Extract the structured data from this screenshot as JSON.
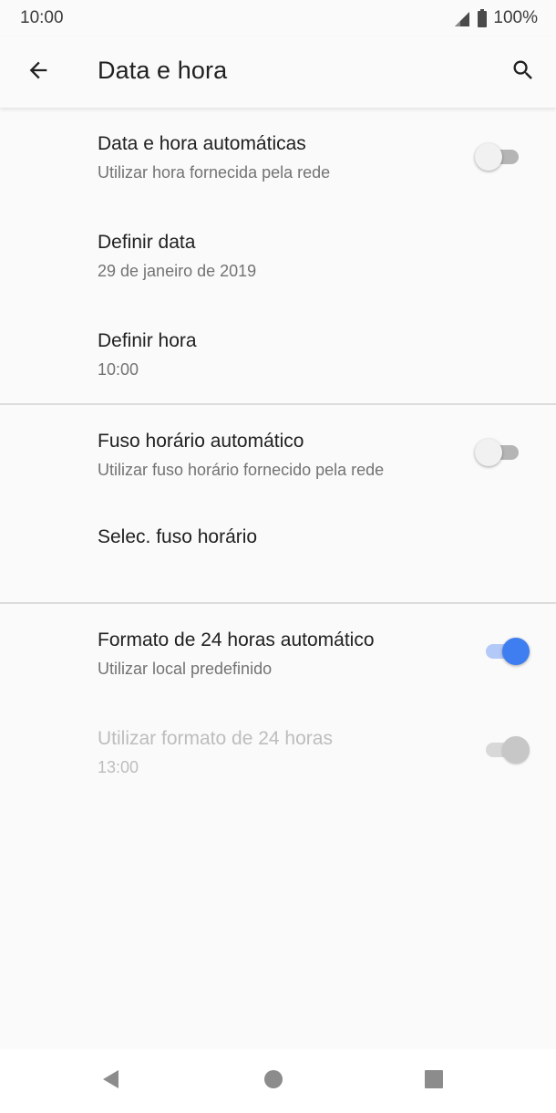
{
  "status_bar": {
    "time": "10:00",
    "battery": "100%",
    "icons": [
      "signal-icon",
      "battery-icon"
    ]
  },
  "app_bar": {
    "title": "Data e hora",
    "back_icon": "arrow-back-icon",
    "search_icon": "search-icon"
  },
  "settings": {
    "auto_datetime": {
      "title": "Data e hora automáticas",
      "summary": "Utilizar hora fornecida pela rede",
      "enabled": false
    },
    "set_date": {
      "title": "Definir data",
      "summary": "29 de janeiro de 2019"
    },
    "set_time": {
      "title": "Definir hora",
      "summary": "10:00"
    },
    "auto_timezone": {
      "title": "Fuso horário automático",
      "summary": "Utilizar fuso horário fornecido pela rede",
      "enabled": false
    },
    "select_timezone": {
      "title": "Selec. fuso horário"
    },
    "auto_24h": {
      "title": "Formato de 24 horas automático",
      "summary": "Utilizar local predefinido",
      "enabled": true
    },
    "use_24h": {
      "title": "Utilizar formato de 24 horas",
      "summary": "13:00",
      "enabled": true,
      "disabled": true
    }
  },
  "nav_bar": {
    "icons": [
      "back-triangle-icon",
      "home-circle-icon",
      "recents-square-icon"
    ]
  },
  "colors": {
    "accent": "#3f7ef0",
    "background": "#fafafa",
    "primary_text": "#212121",
    "secondary_text": "#737373"
  }
}
